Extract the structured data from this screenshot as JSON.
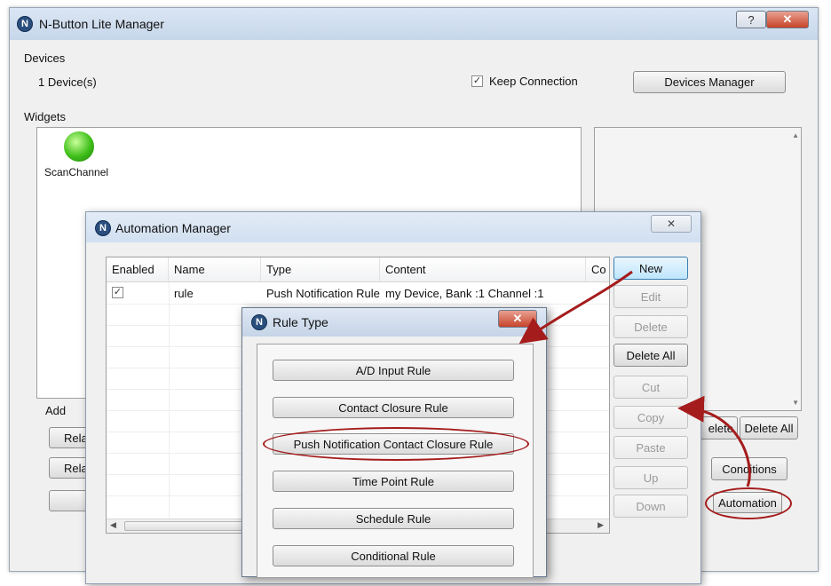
{
  "main_window": {
    "title": "N-Button Lite Manager",
    "app_icon": "n-logo-icon",
    "help_glyph": "?",
    "close_glyph": "✕",
    "devices": {
      "section_label": "Devices",
      "count_text": "1 Device(s)",
      "keep_connection_label": "Keep Connection",
      "keep_connection_checked": true,
      "devices_manager_label": "Devices Manager"
    },
    "widgets": {
      "section_label": "Widgets",
      "items": [
        {
          "label": "ScanChannel",
          "status_color": "#3fbf1a"
        }
      ]
    },
    "add_label": "Add",
    "left_buttons": [
      "Rela",
      "Rela",
      ""
    ],
    "right_buttons": {
      "delete_partial": "elete",
      "delete_all": "Delete All",
      "conditions": "Conditions",
      "automation": "Automation"
    }
  },
  "automation_manager": {
    "title": "Automation Manager",
    "close_glyph": "✕",
    "columns": [
      "Enabled",
      "Name",
      "Type",
      "Content",
      "Co"
    ],
    "rows": [
      {
        "enabled": true,
        "name": "rule",
        "type": "Push Notification Rule",
        "content": "my Device, Bank :1 Channel :1"
      }
    ],
    "side_buttons": [
      {
        "label": "New",
        "enabled": true
      },
      {
        "label": "Edit",
        "enabled": false
      },
      {
        "label": "Delete",
        "enabled": false
      },
      {
        "label": "Delete All",
        "enabled": true
      },
      {
        "label": "Cut",
        "enabled": false
      },
      {
        "label": "Copy",
        "enabled": false
      },
      {
        "label": "Paste",
        "enabled": false
      },
      {
        "label": "Up",
        "enabled": false
      },
      {
        "label": "Down",
        "enabled": false
      }
    ]
  },
  "rule_type": {
    "title": "Rule Type",
    "close_glyph": "✕",
    "options": [
      "A/D Input Rule",
      "Contact Closure Rule",
      "Push Notification Contact Closure Rule",
      "Time Point Rule",
      "Schedule Rule",
      "Conditional Rule"
    ]
  },
  "annotation_color": "#a51c1c"
}
